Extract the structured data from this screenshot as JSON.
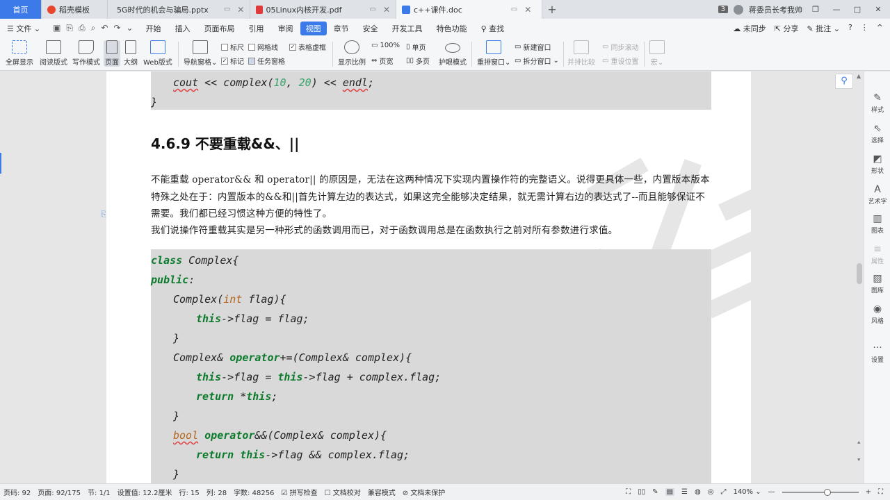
{
  "tabs": {
    "home": "首页",
    "items": [
      {
        "label": "稻壳模板",
        "icon_color": "#e8452c",
        "active": false
      },
      {
        "label": "5G时代的机会与骗局.pptx",
        "icon_color": "#e8752c",
        "active": false
      },
      {
        "label": "05Linux内核开发.pdf",
        "icon_color": "#e03b3b",
        "active": false
      },
      {
        "label": "c++课件.doc",
        "icon_color": "#3b7ae8",
        "active": true
      }
    ],
    "new_tab": "+",
    "count_badge": "3",
    "user": "蒋委员长考我帅"
  },
  "menu": {
    "file": "文件",
    "items": [
      "开始",
      "插入",
      "页面布局",
      "引用",
      "审阅",
      "视图",
      "章节",
      "安全",
      "开发工具",
      "特色功能"
    ],
    "active": "视图",
    "search": "查找",
    "right": [
      "未同步",
      "分享",
      "批注"
    ]
  },
  "ribbon": {
    "buttons": [
      "全屏显示",
      "阅读版式",
      "写作模式",
      "页面",
      "大纲",
      "Web版式"
    ],
    "nav": "导航窗格",
    "checks": [
      {
        "label": "标尺",
        "checked": false
      },
      {
        "label": "网格线",
        "checked": false
      },
      {
        "label": "表格虚框",
        "checked": true
      },
      {
        "label": "标记",
        "checked": true
      },
      {
        "label": "任务窗格",
        "checked": false
      }
    ],
    "zoom_ratio": "显示比例",
    "zoom100": "100%",
    "page_width": "页宽",
    "single": "单页",
    "multi": "多页",
    "eye": "护眼模式",
    "rearrange": "重排窗口",
    "new_window": "新建窗口",
    "split": "拆分窗口",
    "side_by_side": "并排比较",
    "sync_scroll": "同步滚动",
    "reset_pos": "重设位置",
    "macro": "宏"
  },
  "document": {
    "top_code": [
      "cout << complex(10, 20) << endl;",
      "}"
    ],
    "heading": "4.6.9  不要重载&&、||",
    "paragraph1": "不能重载 operator&& 和 operator|| 的原因是，无法在这两种情况下实现内置操作符的完整语义。说得更具体一些，内置版本版本特殊之处在于：内置版本的&&和||首先计算左边的表达式，如果这完全能够决定结果，就无需计算右边的表达式了--而且能够保证不需要。我们都已经习惯这种方便的特性了。",
    "paragraph2": "我们说操作符重载其实是另一种形式的函数调用而已，对于函数调用总是在函数执行之前对所有参数进行求值。",
    "code_lines": [
      "class Complex{",
      "public:",
      "    Complex(int flag){",
      "        this->flag = flag;",
      "    }",
      "    Complex& operator+=(Complex& complex){",
      "        this->flag = this->flag + complex.flag;",
      "        return *this;",
      "    }",
      "    bool operator&&(Complex& complex){",
      "        return this->flag && complex.flag;",
      "    }"
    ]
  },
  "sidepanel": [
    "样式",
    "选择",
    "形状",
    "艺术字",
    "图表",
    "属性",
    "图库",
    "风格",
    "设置"
  ],
  "status": {
    "page_num": "页码: 92",
    "page_of": "页面: 92/175",
    "section": "节: 1/1",
    "setting": "设置值: 12.2厘米",
    "row": "行: 15",
    "col": "列: 28",
    "words": "字数: 48256",
    "spell": "拼写检查",
    "proof": "文档校对",
    "compat": "兼容模式",
    "unprotected": "文档未保护",
    "zoom": "140%",
    "zoom_level": 0.6
  }
}
